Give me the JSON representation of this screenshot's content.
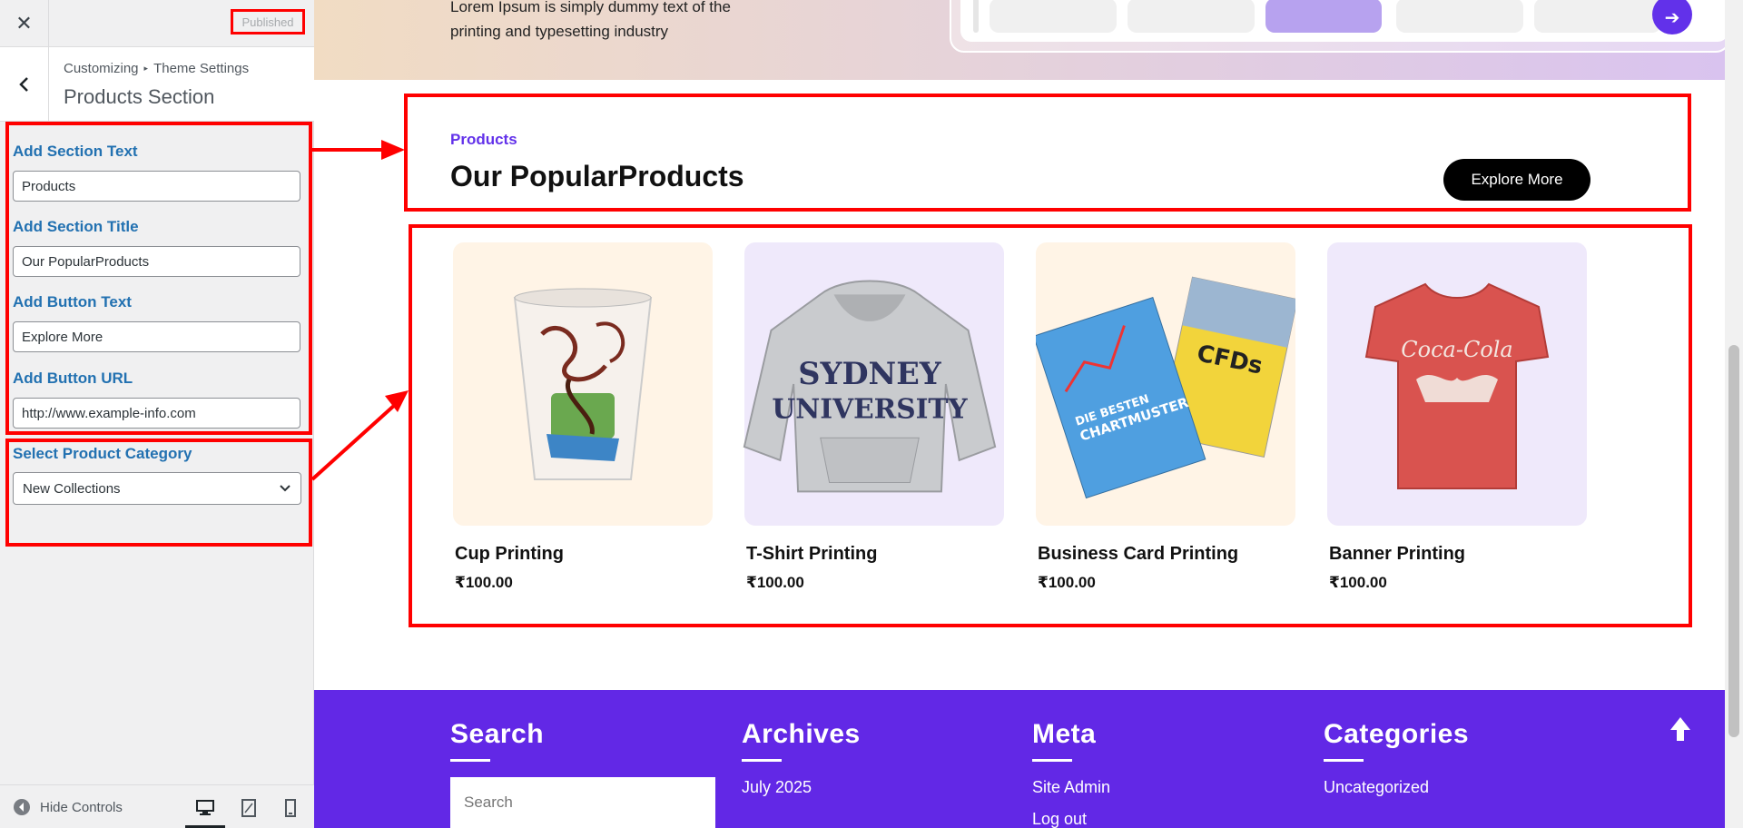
{
  "sidebar": {
    "close_icon": "✕",
    "published_label": "Published",
    "breadcrumb": {
      "root": "Customizing",
      "separator": "▸",
      "parent": "Theme Settings"
    },
    "section_title": "Products Section",
    "controls": {
      "section_text": {
        "label": "Add Section Text",
        "value": "Products"
      },
      "section_title": {
        "label": "Add Section Title",
        "value": "Our PopularProducts"
      },
      "button_text": {
        "label": "Add Button Text",
        "value": "Explore More"
      },
      "button_url": {
        "label": "Add Button URL",
        "value": "http://www.example-info.com"
      },
      "product_category": {
        "label": "Select Product Category",
        "value": "New Collections"
      }
    },
    "footer": {
      "hide_controls_label": "Hide Controls"
    }
  },
  "preview": {
    "hero_text": "Lorem Ipsum is simply dummy text of the printing and typesetting industry",
    "section": {
      "text": "Products",
      "title": "Our PopularProducts",
      "button": "Explore More"
    },
    "products": [
      {
        "name": "Cup Printing",
        "price": "₹100.00",
        "bg": "#fff4e6",
        "icon": "cup-image"
      },
      {
        "name": "T-Shirt Printing",
        "price": "₹100.00",
        "bg": "#efe9fb",
        "icon": "hoodie-image"
      },
      {
        "name": "Business Card Printing",
        "price": "₹100.00",
        "bg": "#fff4e6",
        "icon": "books-image"
      },
      {
        "name": "Banner Printing",
        "price": "₹100.00",
        "bg": "#efe9fb",
        "icon": "tshirt-image"
      }
    ],
    "hoodie_print": [
      "SYDNEY",
      "UNIVERSITY"
    ],
    "book_titles": {
      "left": [
        "DIE BESTEN",
        "CHARTMUSTER"
      ],
      "right": "CFDs"
    },
    "tshirt_logo": "Coca-Cola",
    "footer": {
      "search": {
        "title": "Search",
        "placeholder": "Search"
      },
      "archives": {
        "title": "Archives",
        "items": [
          "July 2025"
        ]
      },
      "meta": {
        "title": "Meta",
        "items": [
          "Site Admin",
          "Log out"
        ]
      },
      "categories": {
        "title": "Categories",
        "items": [
          "Uncategorized"
        ]
      }
    }
  },
  "colors": {
    "accent": "#6231ea",
    "footer_bg": "#6228e6",
    "annotation_red": "#ff0000",
    "label_blue": "#2271b1"
  }
}
